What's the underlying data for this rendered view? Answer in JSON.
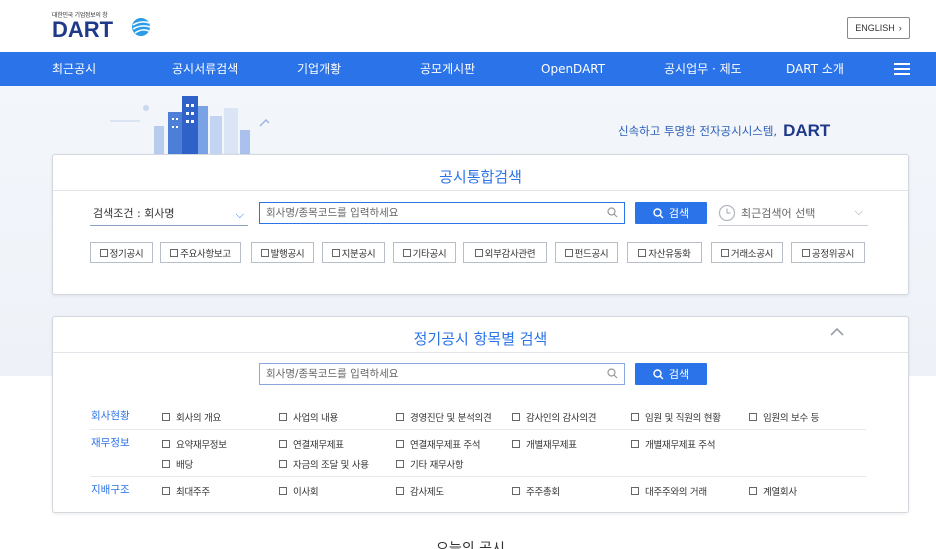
{
  "header": {
    "logo_tagline": "대한민국 기업정보의 창",
    "logo_text": "DART",
    "english_label": "ENGLISH",
    "english_chevron": "›"
  },
  "nav": {
    "items": [
      "최근공시",
      "공시서류검색",
      "기업개황",
      "공모게시판",
      "OpenDART",
      "공시업무 · 제도",
      "DART 소개"
    ]
  },
  "hero": {
    "slogan": "신속하고 투명한 전자공시시스템,",
    "slogan_brand": "DART"
  },
  "integrated_search": {
    "title": "공시통합검색",
    "condition": "검색조건 : 회사명",
    "placeholder": "회사명/종목코드를 입력하세요",
    "search_label": "검색",
    "recent_label": "최근검색어 선택",
    "filters": [
      "정기공시",
      "주요사항보고",
      "발행공시",
      "지분공시",
      "기타공시",
      "외부감사관련",
      "펀드공시",
      "자산유동화",
      "거래소공시",
      "공정위공시"
    ]
  },
  "periodic_search": {
    "title": "정기공시 항목별 검색",
    "placeholder": "회사명/종목코드를 입력하세요",
    "search_label": "검색",
    "categories": [
      {
        "label": "회사현황",
        "items": [
          "회사의 개요",
          "사업의 내용",
          "경영진단 및 분석의견",
          "감사인의 감사의견",
          "임원 및 직원의 현황",
          "임원의 보수 등"
        ]
      },
      {
        "label": "재무정보",
        "items": [
          "요약재무정보",
          "연결재무제표",
          "연결재무제표 주석",
          "개별재무제표",
          "개별재무제표 주석",
          "배당",
          "자금의 조달 및 사용",
          "기타 재무사항"
        ]
      },
      {
        "label": "지배구조",
        "items": [
          "최대주주",
          "이사회",
          "감사제도",
          "주주총회",
          "대주주와의 거래",
          "계열회사"
        ]
      }
    ]
  },
  "bottom": {
    "title": "오늘의 공시"
  },
  "colors": {
    "primary": "#2b73e8",
    "brand_navy": "#1f3a8a"
  }
}
